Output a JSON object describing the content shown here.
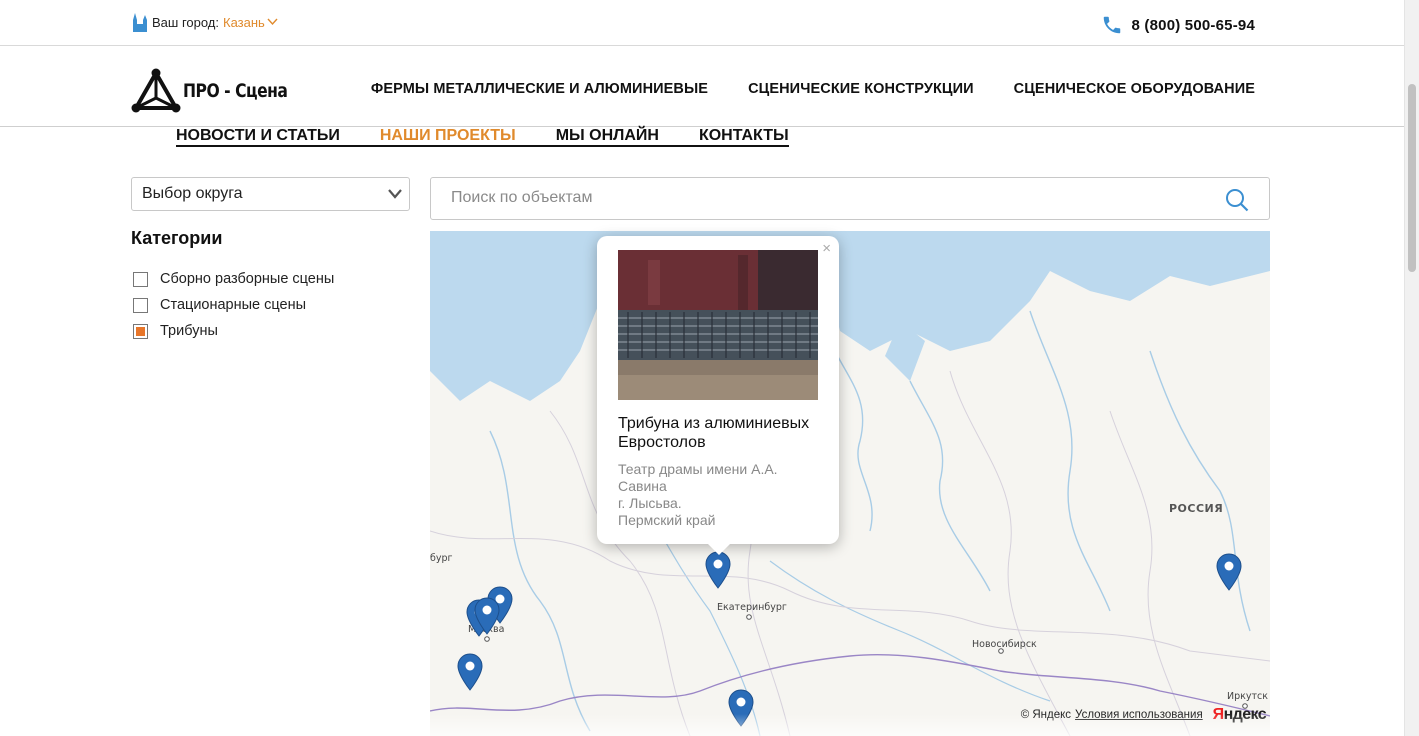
{
  "topbar": {
    "city_label": "Ваш город:",
    "city_value": "Казань",
    "phone": "8 (800) 500-65-94"
  },
  "header": {
    "logo_text": "ПРО - Сцена",
    "nav": [
      "ФЕРМЫ МЕТАЛЛИЧЕСКИЕ И АЛЮМИНИЕВЫЕ",
      "СЦЕНИЧЕСКИЕ КОНСТРУКЦИИ",
      "СЦЕНИЧЕСКОЕ ОБОРУДОВАНИЕ"
    ],
    "subnav": [
      "НОВОСТИ И СТАТЬИ",
      "НАШИ ПРОЕКТЫ",
      "МЫ ОНЛАЙН",
      "КОНТАКТЫ"
    ],
    "subnav_active": "НАШИ ПРОЕКТЫ"
  },
  "filters": {
    "district_select": "Выбор округа",
    "categories_title": "Категории",
    "categories": [
      {
        "label": "Сборно разборные сцены",
        "checked": false
      },
      {
        "label": "Стационарные сцены",
        "checked": false
      },
      {
        "label": "Трибуны",
        "checked": true
      }
    ]
  },
  "search": {
    "placeholder": "Поиск по объектам"
  },
  "map": {
    "labels": {
      "russia": "РОССИЯ",
      "ekaterinburg": "Екатеринбург",
      "novosibirsk": "Новосибирск",
      "irkutsk": "Иркутск",
      "moscow": "Москва",
      "spb_fragment": "бург"
    },
    "copyright": "© Яндекс",
    "terms": "Условия использования",
    "logo_ya": "Я",
    "logo_rest": "ндекс",
    "popup": {
      "close": "×",
      "title": "Трибуна из алюминиевых Евростолов",
      "theatre": "Театр драмы имени А.А. Савина",
      "town": "г. Лысьва.",
      "region": "Пермский край"
    }
  },
  "colors": {
    "accent": "#e08a2c",
    "pin": "#2a6cb8",
    "water": "#bcd9ee",
    "checkbox_checked": "#e8762a"
  }
}
